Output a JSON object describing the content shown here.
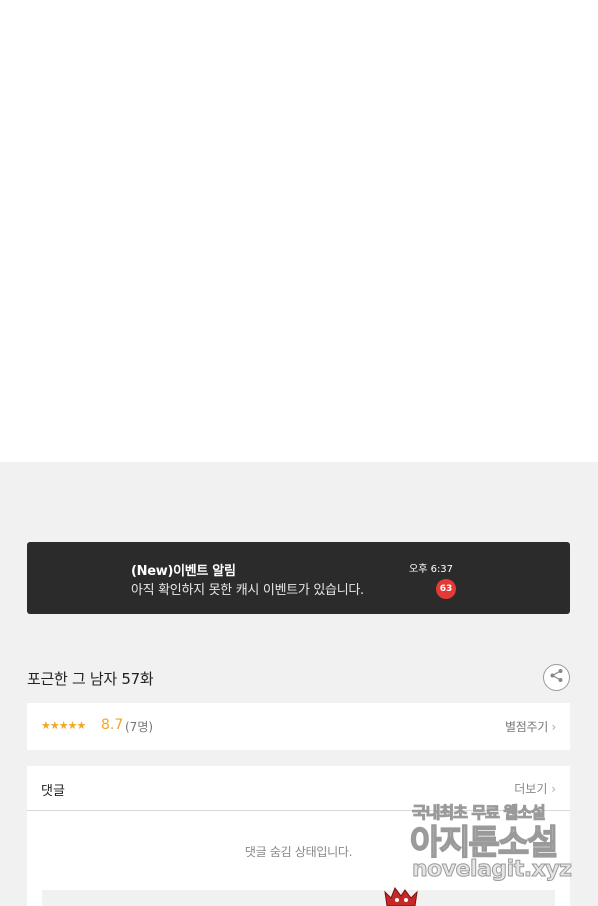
{
  "notification": {
    "title": "(New)이벤트 알림",
    "message": "아직 확인하지 못한 캐시 이벤트가 있습니다.",
    "time": "오후 6:37",
    "badge": "63"
  },
  "episode": {
    "title": "포근한 그 남자 57화",
    "share_icon": "share-icon"
  },
  "rating": {
    "stars": "★★★★★",
    "score": "8.7",
    "count": "(7명)",
    "rate_link": "별점주기",
    "rating_value": 8.7
  },
  "comments": {
    "label": "댓글",
    "more_link": "더보기",
    "hidden_message": "댓글 숨김 상태입니다."
  },
  "watermark": {
    "line1_a": "국내최초 무료 ",
    "line1_b": "웹소설",
    "line2": "아지툰소설",
    "line3": "novelagit.xyz"
  },
  "colors": {
    "accent": "#f5a623",
    "badge": "#e53935",
    "notification_bg": "#2b2b2b",
    "page_bg": "#f1f1f1"
  }
}
